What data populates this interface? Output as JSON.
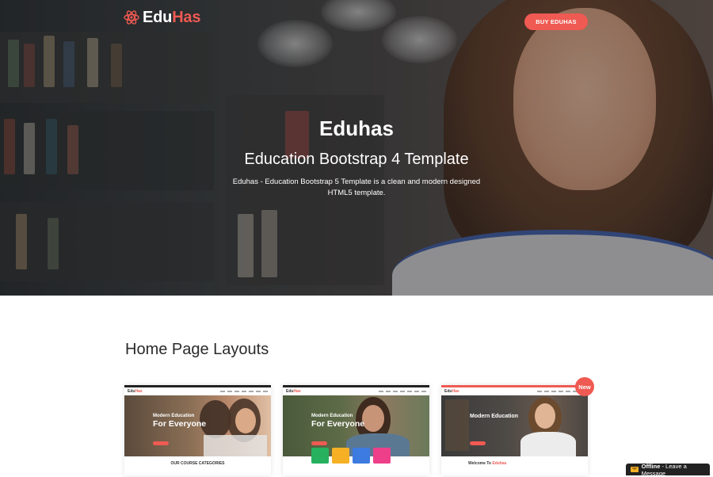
{
  "brand": {
    "name_prefix": "Edu",
    "name_suffix": "Has",
    "accent": "#ef5a52"
  },
  "header": {
    "buy_button": "BUY EDUHAS"
  },
  "hero": {
    "title": "Eduhas",
    "subtitle": "Education Bootstrap 4 Template",
    "description": "Eduhas - Education Bootstrap 5 Template is a clean and modern designed HTML5 template."
  },
  "layouts": {
    "title": "Home Page Layouts",
    "cards": [
      {
        "mini_logo_prefix": "Edu",
        "mini_logo_suffix": "Has",
        "hero_small": "Modern Education",
        "hero_big": "For Everyone",
        "footer_prefix": "OUR COURSE CATEGORIES",
        "footer_suffix": ""
      },
      {
        "mini_logo_prefix": "Edu",
        "mini_logo_suffix": "Has",
        "hero_small": "Modern Education",
        "hero_big": "For Everyone",
        "footer_prefix": "",
        "footer_suffix": ""
      },
      {
        "mini_logo_prefix": "Edu",
        "mini_logo_suffix": "Has",
        "hero_small": "Modern Education",
        "hero_big": "",
        "footer_prefix": "Welcome To ",
        "footer_suffix": "Eduhas"
      }
    ],
    "new_badge": "New"
  },
  "chat": {
    "status": "Offline",
    "label": " - Leave a Message"
  }
}
